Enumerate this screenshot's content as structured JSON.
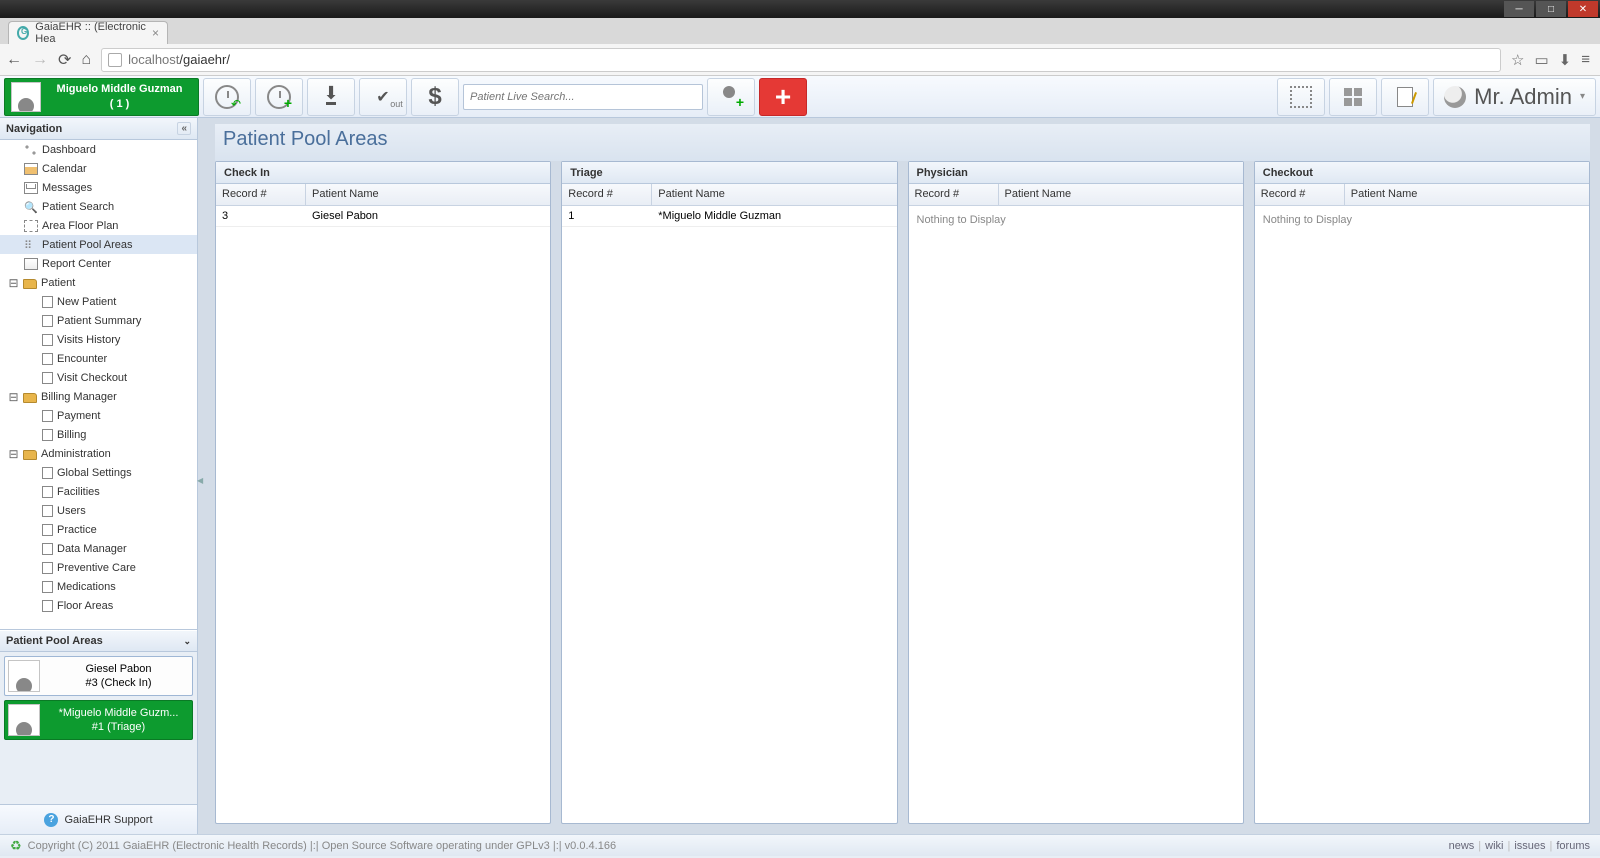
{
  "browser": {
    "tab_title": "GaiaEHR :: (Electronic Hea",
    "url_host": "localhost",
    "url_path": "/gaiaehr/"
  },
  "toolbar": {
    "patient_badge": {
      "name": "Miguelo Middle Guzman",
      "sub": "( 1 )"
    },
    "search_placeholder": "Patient Live Search...",
    "admin_name": "Mr. Admin"
  },
  "sidebar": {
    "nav_title": "Navigation",
    "items": {
      "dashboard": "Dashboard",
      "calendar": "Calendar",
      "messages": "Messages",
      "patient_search": "Patient Search",
      "area_floor_plan": "Area Floor Plan",
      "patient_pool_areas": "Patient Pool Areas",
      "report_center": "Report Center",
      "patient": "Patient",
      "new_patient": "New Patient",
      "patient_summary": "Patient Summary",
      "visits_history": "Visits History",
      "encounter": "Encounter",
      "visit_checkout": "Visit Checkout",
      "billing_manager": "Billing Manager",
      "payment": "Payment",
      "billing": "Billing",
      "administration": "Administration",
      "global_settings": "Global Settings",
      "facilities": "Facilities",
      "users": "Users",
      "practice": "Practice",
      "data_manager": "Data Manager",
      "preventive_care": "Preventive Care",
      "medications": "Medications",
      "floor_areas": "Floor Areas"
    },
    "pool_title": "Patient Pool Areas",
    "pool_cards": [
      {
        "name": "Giesel Pabon",
        "sub": "#3 (Check In)"
      },
      {
        "name": "*Miguelo Middle Guzm...",
        "sub": "#1 (Triage)"
      }
    ],
    "support": "GaiaEHR Support"
  },
  "page": {
    "title": "Patient Pool Areas",
    "panels": [
      {
        "title": "Check In",
        "cols": [
          "Record #",
          "Patient Name"
        ],
        "rows": [
          {
            "rec": "3",
            "name": "Giesel Pabon"
          }
        ],
        "empty": null
      },
      {
        "title": "Triage",
        "cols": [
          "Record #",
          "Patient Name"
        ],
        "rows": [
          {
            "rec": "1",
            "name": "*Miguelo Middle Guzman"
          }
        ],
        "empty": null
      },
      {
        "title": "Physician",
        "cols": [
          "Record #",
          "Patient Name"
        ],
        "rows": [],
        "empty": "Nothing to Display"
      },
      {
        "title": "Checkout",
        "cols": [
          "Record #",
          "Patient Name"
        ],
        "rows": [],
        "empty": "Nothing to Display"
      }
    ]
  },
  "footer": {
    "copyright": "Copyright (C) 2011 GaiaEHR (Electronic Health Records) |:| Open Source Software operating under GPLv3 |:| v0.0.4.166",
    "links": [
      "news",
      "wiki",
      "issues",
      "forums"
    ]
  }
}
